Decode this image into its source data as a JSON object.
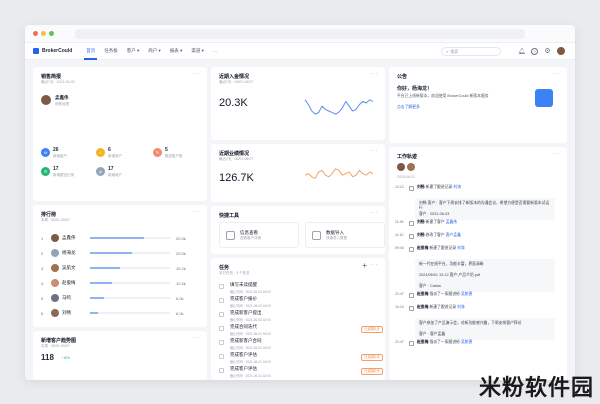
{
  "colors": {
    "accent": "#2563eb",
    "blue_circle": "#3b82f6",
    "yellow_circle": "#f5b324",
    "red_circle": "#f08c6c",
    "green_circle": "#22b573",
    "gray_circle": "#94a3b8",
    "line_blue": "#5a8ef0",
    "line_orange": "#f4a462"
  },
  "topnav": {
    "logo": "BrokerCould",
    "items": [
      "首页",
      "任务板",
      "客户 ▾",
      "商户 ▾",
      "报表 ▾",
      "渠道 ▾",
      "···"
    ],
    "search_placeholder": "搜索"
  },
  "sales": {
    "title": "销售简报",
    "subtitle": "最近7天 · 2021-06-03",
    "person_name": "孟鑫伟",
    "person_role": "销售经理",
    "stats": [
      {
        "value": "26",
        "label": "新增客户"
      },
      {
        "value": "6",
        "label": "新增商户"
      },
      {
        "value": "5",
        "label": "跟进客户数"
      },
      {
        "value": "17",
        "label": "新增跟进记录"
      },
      {
        "value": "17",
        "label": "新增商户"
      }
    ]
  },
  "rank": {
    "title": "排行榜",
    "subtitle": "本周 · 06/01-06/07",
    "rows": [
      {
        "num": "1",
        "name": "孟鑫伟",
        "value": "20.5k"
      },
      {
        "num": "2",
        "name": "杨海龙",
        "value": "20.5k"
      },
      {
        "num": "3",
        "name": "吴航文",
        "value": "15.2k"
      },
      {
        "num": "4",
        "name": "赵俊梅",
        "value": "12.5k"
      },
      {
        "num": "5",
        "name": "马鸣",
        "value": "6.0k"
      },
      {
        "num": "6",
        "name": "刘畅",
        "value": "6.0k"
      }
    ]
  },
  "newcustomers": {
    "title": "新增客户趋势图",
    "subtitle": "本周 · 06/01-06/07",
    "value": "118",
    "change": "↑ 8%"
  },
  "stat_cards": [
    {
      "title": "近期入金情况",
      "subtitle": "最近7天 · 06/01-06/07",
      "value": "20.3K"
    },
    {
      "title": "近期业绩情况",
      "subtitle": "最近7天 · 06/01-06/07",
      "value": "126.7K"
    }
  ],
  "chart_data": [
    {
      "type": "line",
      "title": "近期入金情况",
      "x": [
        1,
        2,
        3,
        4,
        5,
        6,
        7,
        8,
        9,
        10,
        11,
        12,
        13,
        14,
        15,
        16,
        17,
        18,
        19,
        20,
        21
      ],
      "values": [
        60,
        45,
        25,
        15,
        20,
        40,
        30,
        25,
        20,
        15,
        22,
        35,
        55,
        40,
        25,
        30,
        45,
        55,
        50,
        60,
        55
      ],
      "ylim": [
        0,
        100
      ],
      "grid": false,
      "axes": false
    },
    {
      "type": "line",
      "title": "近期业绩情况",
      "x": [
        1,
        2,
        3,
        4,
        5,
        6,
        7,
        8,
        9,
        10,
        11,
        12,
        13,
        14,
        15,
        16,
        17,
        18,
        19,
        20,
        21
      ],
      "values": [
        40,
        45,
        35,
        30,
        50,
        55,
        40,
        35,
        45,
        60,
        55,
        40,
        45,
        50,
        35,
        40,
        55,
        45,
        40,
        50,
        45
      ],
      "ylim": [
        0,
        100
      ],
      "grid": false,
      "axes": false
    }
  ],
  "tools": {
    "title": "快捷工具",
    "items": [
      {
        "name": "信息查看",
        "desc": "查看客户详情"
      },
      {
        "name": "数据导入",
        "desc": "快速导入数据"
      }
    ]
  },
  "tasks": {
    "title": "任务",
    "subtitle": "本日任务 · 3 个任务",
    "rows": [
      {
        "title": "填写未读提醒",
        "date": "截止时间 · 2021-06-03 18:00",
        "overdue": ""
      },
      {
        "title": "完成客户报价",
        "date": "截止时间 · 2021-06-03 18:00",
        "overdue": ""
      },
      {
        "title": "完成新客户提出",
        "date": "截止时间 · 2021-06-03 18:00",
        "overdue": ""
      },
      {
        "title": "完成合同迭代",
        "date": "截止时间 · 2021-06-02 18:00",
        "overdue": "已逾期1天"
      },
      {
        "title": "完成新客户合同",
        "date": "截止时间 · 2021-06-02 18:00",
        "overdue": ""
      },
      {
        "title": "完成客户评估",
        "date": "截止时间 · 2021-06-01 18:00",
        "overdue": "已逾期2天"
      },
      {
        "title": "完成客户评估",
        "date": "截止时间 · 2021-06-01 18:00",
        "overdue": "已逾期2天"
      }
    ]
  },
  "notice": {
    "title": "公告",
    "greeting": "你好，杨海龙！",
    "line1": "平台已上线新版本，欢迎使用 BrokerCould 新版本服务",
    "line2": "点击了解更多"
  },
  "work": {
    "title": "工作轨迹",
    "date": "2020-06-01",
    "entries": [
      {
        "time": "12:12",
        "who": "刘畅",
        "text": "新建了跟进记录",
        "link": "刘涛"
      },
      {
        "time": "",
        "who": "",
        "text": "刘畅 客户：客户下周安排了新版本的沟通会议，希望方便是否需要新版本试运行",
        "link": ""
      },
      {
        "time": "",
        "who": "",
        "text": "客户 · 2021-06-03",
        "link": ""
      },
      {
        "time": "11:45",
        "who": "刘畅",
        "text": "新建了客户",
        "link": "孟鑫伟"
      },
      {
        "time": "11:10",
        "who": "刘畅",
        "text": "修改了客户",
        "link": "客户孟鑫"
      },
      {
        "time": "09:40",
        "who": "赵俊梅",
        "text": "新建了跟进记录",
        "link": "刘涛"
      },
      {
        "time": "",
        "who": "",
        "text": "新一代在线平台，功能丰富，界面清晰",
        "link": ""
      },
      {
        "time": "",
        "who": "",
        "text": "2021/06/01 10:12 客户-产品介绍.pdf",
        "link": ""
      },
      {
        "time": "",
        "who": "",
        "text": "客户 · Carlos",
        "link": ""
      },
      {
        "time": "21:47",
        "who": "赵俊梅",
        "text": "指派了一条跟进给",
        "link": "吴航德"
      },
      {
        "time": "10:10",
        "who": "赵俊梅",
        "text": "新建了跟进记录",
        "link": "刘涛"
      },
      {
        "time": "",
        "who": "",
        "text": "客户参加了产品演示会，对新功能感兴趣，下周安排客户拜访",
        "link": ""
      },
      {
        "time": "",
        "who": "",
        "text": "客户 · 客户孟鑫",
        "link": ""
      },
      {
        "time": "21:47",
        "who": "赵俊梅",
        "text": "指派了一条跟进给",
        "link": "吴航德"
      }
    ]
  },
  "watermark": "米粉软件园"
}
